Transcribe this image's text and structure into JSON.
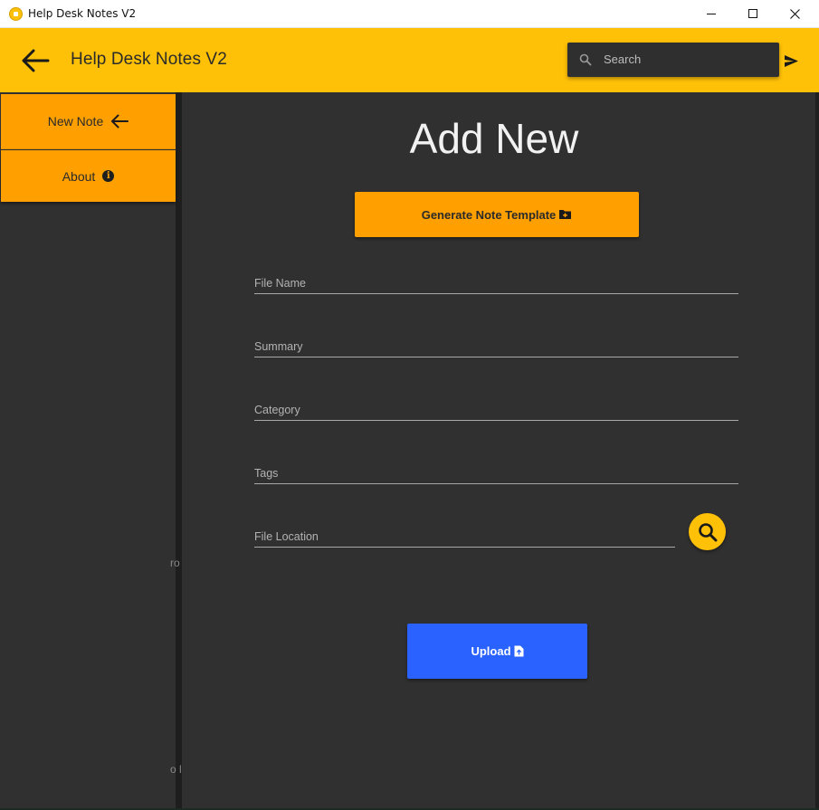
{
  "window": {
    "title": "Help Desk Notes V2",
    "controls": [
      "minimize",
      "maximize",
      "close"
    ]
  },
  "header": {
    "title": "Help Desk Notes V2",
    "back_icon": "arrow-left-icon",
    "search_placeholder": "Search",
    "send_icon": "send-icon",
    "color": "#ffc107"
  },
  "sidebar": {
    "items": [
      {
        "label": "New Note",
        "icon": "arrow-left-icon"
      },
      {
        "label": "About",
        "icon": "info-icon"
      }
    ],
    "item_color": "#ffa000",
    "fragments": [
      "ro",
      "o l"
    ]
  },
  "main": {
    "heading": "Add New",
    "generate_button": {
      "label": "Generate Note Template",
      "icon": "folder-plus-icon"
    },
    "fields": [
      {
        "label": "File Name",
        "value": ""
      },
      {
        "label": "Summary",
        "value": ""
      },
      {
        "label": "Category",
        "value": ""
      },
      {
        "label": "Tags",
        "value": ""
      },
      {
        "label": "File Location",
        "value": ""
      }
    ],
    "browse_icon": "search-icon",
    "upload_button": {
      "label": "Upload",
      "icon": "file-upload-icon",
      "color": "#2962ff"
    }
  }
}
